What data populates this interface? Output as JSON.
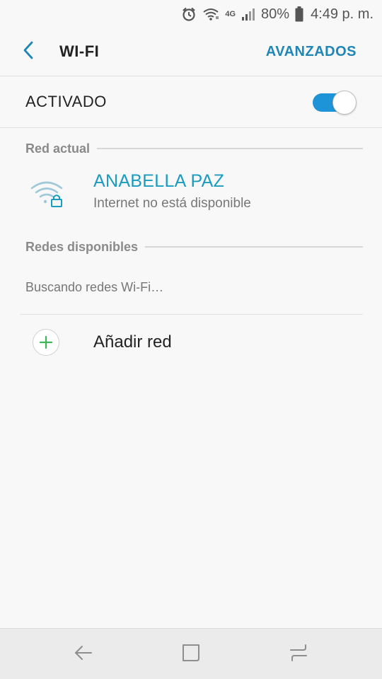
{
  "status_bar": {
    "battery_percent": "80%",
    "time": "4:49 p. m.",
    "network_type": "4G",
    "icons": [
      "alarm-icon",
      "wifi-signal-icon",
      "cell-signal-icon",
      "battery-icon"
    ]
  },
  "header": {
    "title": "WI-FI",
    "advanced_label": "AVANZADOS",
    "back_icon": "back-arrow-icon"
  },
  "wifi_toggle": {
    "label": "ACTIVADO",
    "enabled": true
  },
  "current_network": {
    "section_label": "Red actual",
    "name": "ANABELLA PAZ",
    "status": "Internet no está disponible",
    "icon": "wifi-lock-icon"
  },
  "available_networks": {
    "section_label": "Redes disponibles",
    "searching_text": "Buscando redes Wi-Fi…"
  },
  "add_network": {
    "label": "Añadir red",
    "icon": "plus-icon"
  },
  "nav_bar": {
    "icons": [
      "nav-back-icon",
      "nav-home-icon",
      "nav-recents-icon"
    ]
  },
  "colors": {
    "accent": "#1f87b5",
    "network_name": "#1a9bc0",
    "toggle_on": "#1e94d8",
    "add_plus": "#3fb55a",
    "background": "#f8f8f8"
  }
}
